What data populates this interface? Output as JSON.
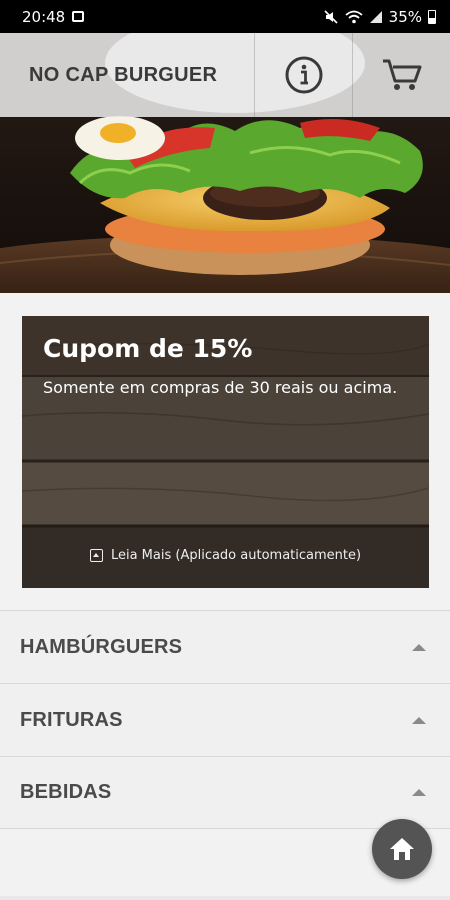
{
  "status_bar": {
    "time": "20:48",
    "battery": "35%",
    "icons": [
      "image-icon",
      "mute-icon",
      "wifi-icon",
      "signal-icon",
      "battery-icon"
    ]
  },
  "header": {
    "title": "NO CAP BURGUER",
    "info_icon": "info-icon",
    "cart_icon": "cart-icon"
  },
  "coupon": {
    "title": "Cupom de 15%",
    "description": "Somente em compras de 30 reais ou acima.",
    "read_more": "Leia Mais (Aplicado automaticamente)"
  },
  "categories": [
    {
      "label": "HAMBÚRGUERS"
    },
    {
      "label": "FRITURAS"
    },
    {
      "label": "BEBIDAS"
    }
  ],
  "fab": {
    "icon": "home-icon"
  },
  "colors": {
    "header_bg": "#e8e8e8",
    "title_text": "#3a3a3a",
    "category_text": "#4a4a4a",
    "fab_bg": "#545454"
  }
}
